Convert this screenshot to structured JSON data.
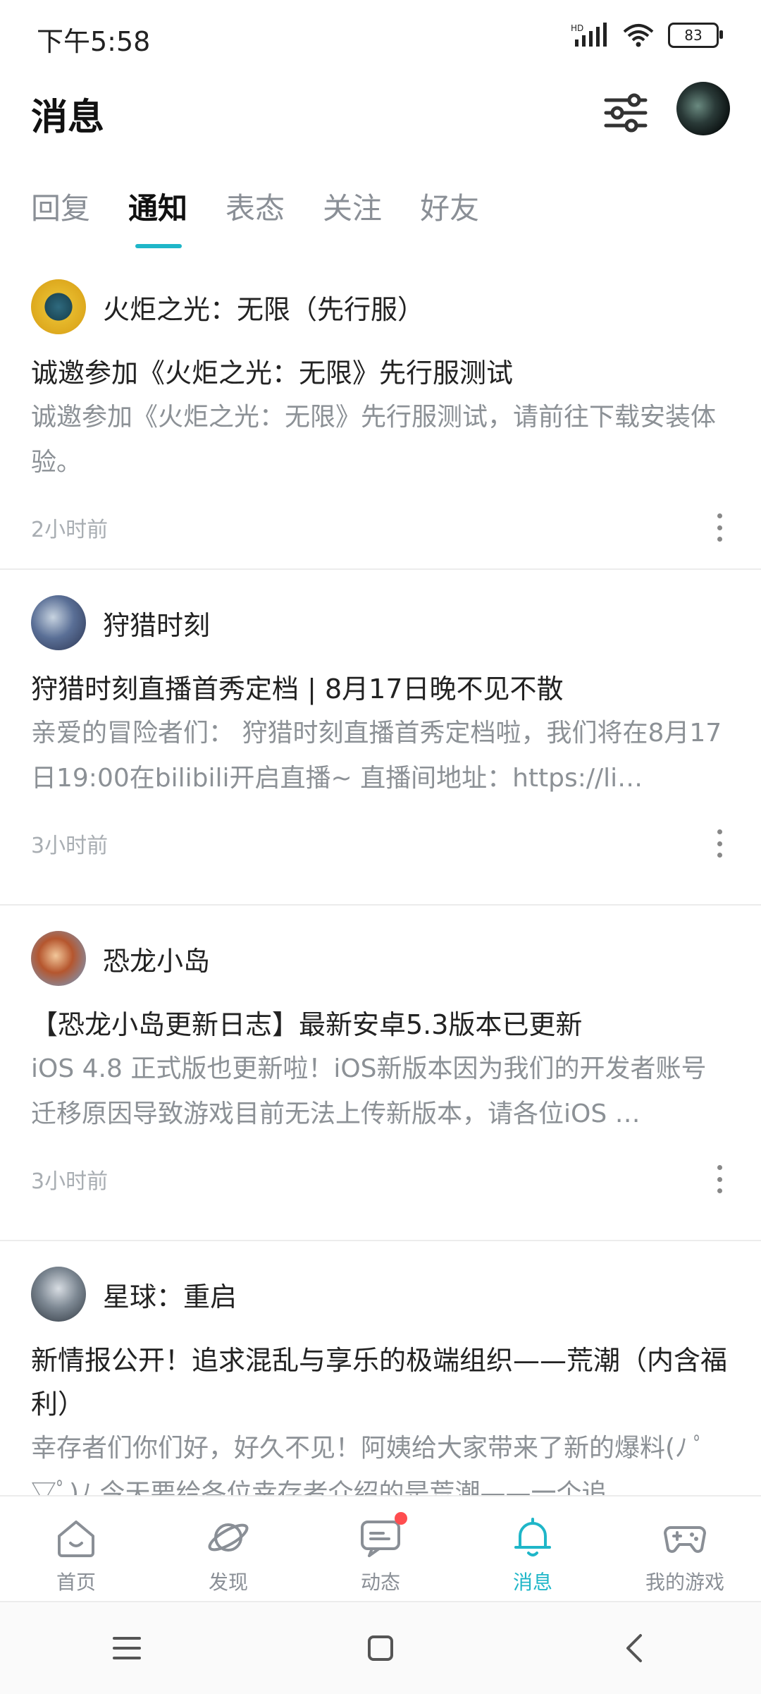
{
  "status_bar": {
    "time": "下午5:58",
    "battery": "83",
    "network": "HD"
  },
  "header": {
    "title": "消息"
  },
  "tabs": [
    {
      "label": "回复",
      "active": false
    },
    {
      "label": "通知",
      "active": true
    },
    {
      "label": "表态",
      "active": false
    },
    {
      "label": "关注",
      "active": false
    },
    {
      "label": "好友",
      "active": false
    }
  ],
  "notifications": [
    {
      "game": "火炬之光：无限（先行服）",
      "title": "诚邀参加《火炬之光：无限》先行服测试",
      "body": "诚邀参加《火炬之光：无限》先行服测试，请前往下载安装体验。",
      "time": "2小时前"
    },
    {
      "game": "狩猎时刻",
      "title": "狩猎时刻直播首秀定档 | 8月17日晚不见不散",
      "body": "亲爱的冒险者们： 狩猎时刻直播首秀定档啦，我们将在8月17日19:00在bilibili开启直播~ 直播间地址：https://li…",
      "time": "3小时前"
    },
    {
      "game": "恐龙小岛",
      "title": "【恐龙小岛更新日志】最新安卓5.3版本已更新",
      "body": "iOS 4.8 正式版也更新啦！iOS新版本因为我们的开发者账号迁移原因导致游戏目前无法上传新版本，请各位iOS …",
      "time": "3小时前"
    },
    {
      "game": "星球：重启",
      "title": "新情报公开！追求混乱与享乐的极端组织——荒潮（内含福利）",
      "body": "幸存者们你们好，好久不见！阿姨给大家带来了新的爆料(ﾉ ﾟ▽ﾟ)ﾉ 今天要给各位幸存者介绍的是荒潮——一个追…",
      "time": ""
    }
  ],
  "bottom_nav": [
    {
      "label": "首页",
      "icon": "home-icon"
    },
    {
      "label": "发现",
      "icon": "planet-icon"
    },
    {
      "label": "动态",
      "icon": "chat-icon",
      "badge": true
    },
    {
      "label": "消息",
      "icon": "bell-icon",
      "active": true
    },
    {
      "label": "我的游戏",
      "icon": "gamepad-icon"
    }
  ],
  "colors": {
    "accent": "#1fb6c8",
    "badge": "#ff4d4f",
    "muted": "#8c9196"
  }
}
